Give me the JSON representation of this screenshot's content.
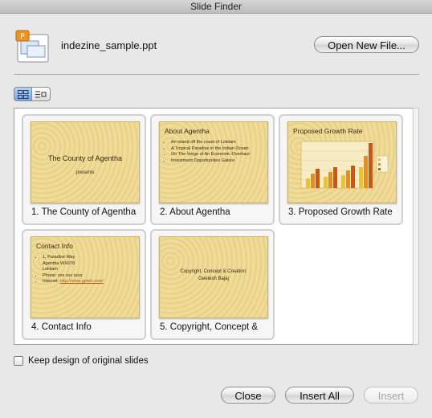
{
  "window": {
    "title": "Slide Finder"
  },
  "file": {
    "name": "indezine_sample.ppt",
    "icon": "powerpoint-file-icon"
  },
  "buttons": {
    "open_new_file": "Open New File...",
    "close": "Close",
    "insert_all": "Insert All",
    "insert": "Insert"
  },
  "view_toggle": {
    "selected": "grid-view",
    "options": [
      "grid-view",
      "list-view"
    ]
  },
  "slides": [
    {
      "label": "1. The County of Agentha",
      "thumb_title": "The County of Agentha",
      "thumb_sub": "presents"
    },
    {
      "label": "2. About Agentha",
      "thumb_title": "About Agentha",
      "bullets": [
        "An island off the coast of Lokilam",
        "A Tropical Paradise in the Indian Ocean",
        "On The Verge of An Economic Overhaul",
        "Investment Opportunities Galore"
      ]
    },
    {
      "label": "3. Proposed Growth Rate",
      "thumb_title": "Proposed Growth Rate"
    },
    {
      "label": "4. Contact Info",
      "thumb_title": "Contact Info",
      "address_1": "1, Paradise Way",
      "address_2": "Agentha WX678",
      "address_3": "Lokilam",
      "phone": "Phone: xxx xxx xxxx",
      "internet_label": "Internet:",
      "internet_link": "http://www.gpteb.com/"
    },
    {
      "label": "5. Copyright, Concept &",
      "thumb_line1": "Copyright, Concept & Creation:",
      "thumb_line2": "Geetesh Bajaj"
    }
  ],
  "keep_design": {
    "label": "Keep design of original slides",
    "checked": false
  },
  "colors": {
    "slide_bg": "#eed794",
    "bar_yellow": "#f4c21a",
    "bar_orange": "#f08a12",
    "bar_red": "#d8520c"
  }
}
